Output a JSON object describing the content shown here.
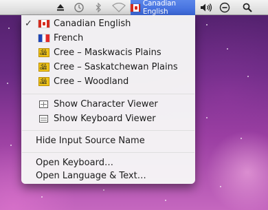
{
  "menubar": {
    "active_item": {
      "label": "Canadian English",
      "flag": "flag-canada-icon"
    },
    "icons": [
      "eject-icon",
      "time-machine-icon",
      "bluetooth-icon",
      "wifi-icon",
      "volume-icon",
      "user-switch-icon",
      "spotlight-icon"
    ]
  },
  "menu": {
    "input_sources": [
      {
        "label": "Canadian English",
        "icon": "flag-canada-icon",
        "checked": true
      },
      {
        "label": "French",
        "icon": "flag-france-icon",
        "checked": false
      },
      {
        "label": "Cree – Maskwacis Plains",
        "icon": "cree-keyboard-icon",
        "checked": false
      },
      {
        "label": "Cree – Saskatchewan Plains",
        "icon": "cree-keyboard-icon",
        "checked": false
      },
      {
        "label": "Cree – Woodland",
        "icon": "cree-keyboard-icon",
        "checked": false
      }
    ],
    "cree_badge": "CREE",
    "viewers": [
      {
        "label": "Show Character Viewer",
        "icon": "character-viewer-icon"
      },
      {
        "label": "Show Keyboard Viewer",
        "icon": "keyboard-viewer-icon"
      }
    ],
    "hide_name": "Hide Input Source Name",
    "open_items": [
      "Open Keyboard…",
      "Open Language & Text…"
    ]
  },
  "colors": {
    "menubar_active": "#3a67d9",
    "menu_bg": "#f6f6f6",
    "cree_badge": "#f0c419"
  }
}
